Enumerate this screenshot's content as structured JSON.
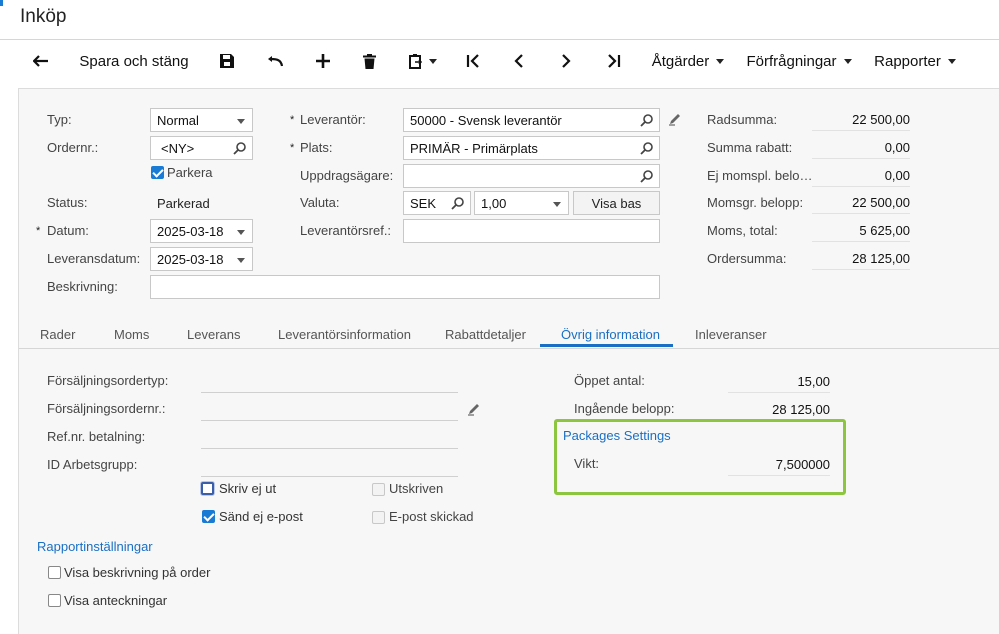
{
  "header": {
    "title": "Inköp"
  },
  "toolbar": {
    "save_close_label": "Spara och stäng",
    "actions_label": "Åtgärder",
    "inquiries_label": "Förfrågningar",
    "reports_label": "Rapporter",
    "icons": [
      "back-arrow-icon",
      "save-icon",
      "undo-icon",
      "add-icon",
      "delete-icon",
      "clipboard-icon",
      "first-record-icon",
      "previous-icon",
      "next-icon",
      "last-record-icon"
    ]
  },
  "form": {
    "type_label": "Typ:",
    "type_value": "Normal",
    "order_nbr_label": "Ordernr.:",
    "order_nbr_value": "<NY>",
    "hold_label": "Parkera",
    "status_label": "Status:",
    "status_value": "Parkerad",
    "date_label": "Datum:",
    "date_value": "2025-03-18",
    "delivery_date_label": "Leveransdatum:",
    "delivery_date_value": "2025-03-18",
    "description_label": "Beskrivning:",
    "description_value": "",
    "vendor_label": "Leverantör:",
    "vendor_value": "50000 - Svensk leverantör",
    "location_label": "Plats:",
    "location_value": "PRIMÄR - Primärplats",
    "owner_label": "Uppdragsägare:",
    "owner_value": "",
    "currency_label": "Valuta:",
    "currency_value": "SEK",
    "rate_value": "1,00",
    "view_base_label": "Visa bas",
    "vendor_ref_label": "Leverantörsref.:",
    "vendor_ref_value": ""
  },
  "totals": [
    {
      "label": "Radsumma:",
      "value": "22 500,00"
    },
    {
      "label": "Summa rabatt:",
      "value": "0,00"
    },
    {
      "label": "Ej momspl. belo…",
      "value": "0,00"
    },
    {
      "label": "Momsgr. belopp:",
      "value": "22 500,00"
    },
    {
      "label": "Moms, total:",
      "value": "5 625,00"
    },
    {
      "label": "Ordersumma:",
      "value": "28 125,00"
    }
  ],
  "tabs": [
    "Rader",
    "Moms",
    "Leverans",
    "Leverantörsinformation",
    "Rabattdetaljer",
    "Övrig information",
    "Inleveranser"
  ],
  "active_tab": "Övrig information",
  "other_info": {
    "so_type_label": "Försäljningsordertyp:",
    "so_nbr_label": "Försäljningsordernr.:",
    "payment_ref_label": "Ref.nr. betalning:",
    "workgroup_label": "ID Arbetsgrupp:",
    "dont_print_label": "Skriv ej ut",
    "printed_label": "Utskriven",
    "dont_email_label": "Sänd ej e-post",
    "emailed_label": "E-post skickad",
    "report_settings_label": "Rapportinställningar",
    "show_desc_label": "Visa beskrivning på order",
    "show_notes_label": "Visa anteckningar",
    "open_qty_label": "Öppet antal:",
    "open_qty_value": "15,00",
    "unbilled_label": "Ingående belopp:",
    "unbilled_value": "28 125,00",
    "packages_label": "Packages Settings",
    "weight_label": "Vikt:",
    "weight_value": "7,500000"
  },
  "colors": {
    "accent": "#1a6fc4",
    "highlight_box": "#8cc63f",
    "checkbox": "#1a7bd5"
  }
}
